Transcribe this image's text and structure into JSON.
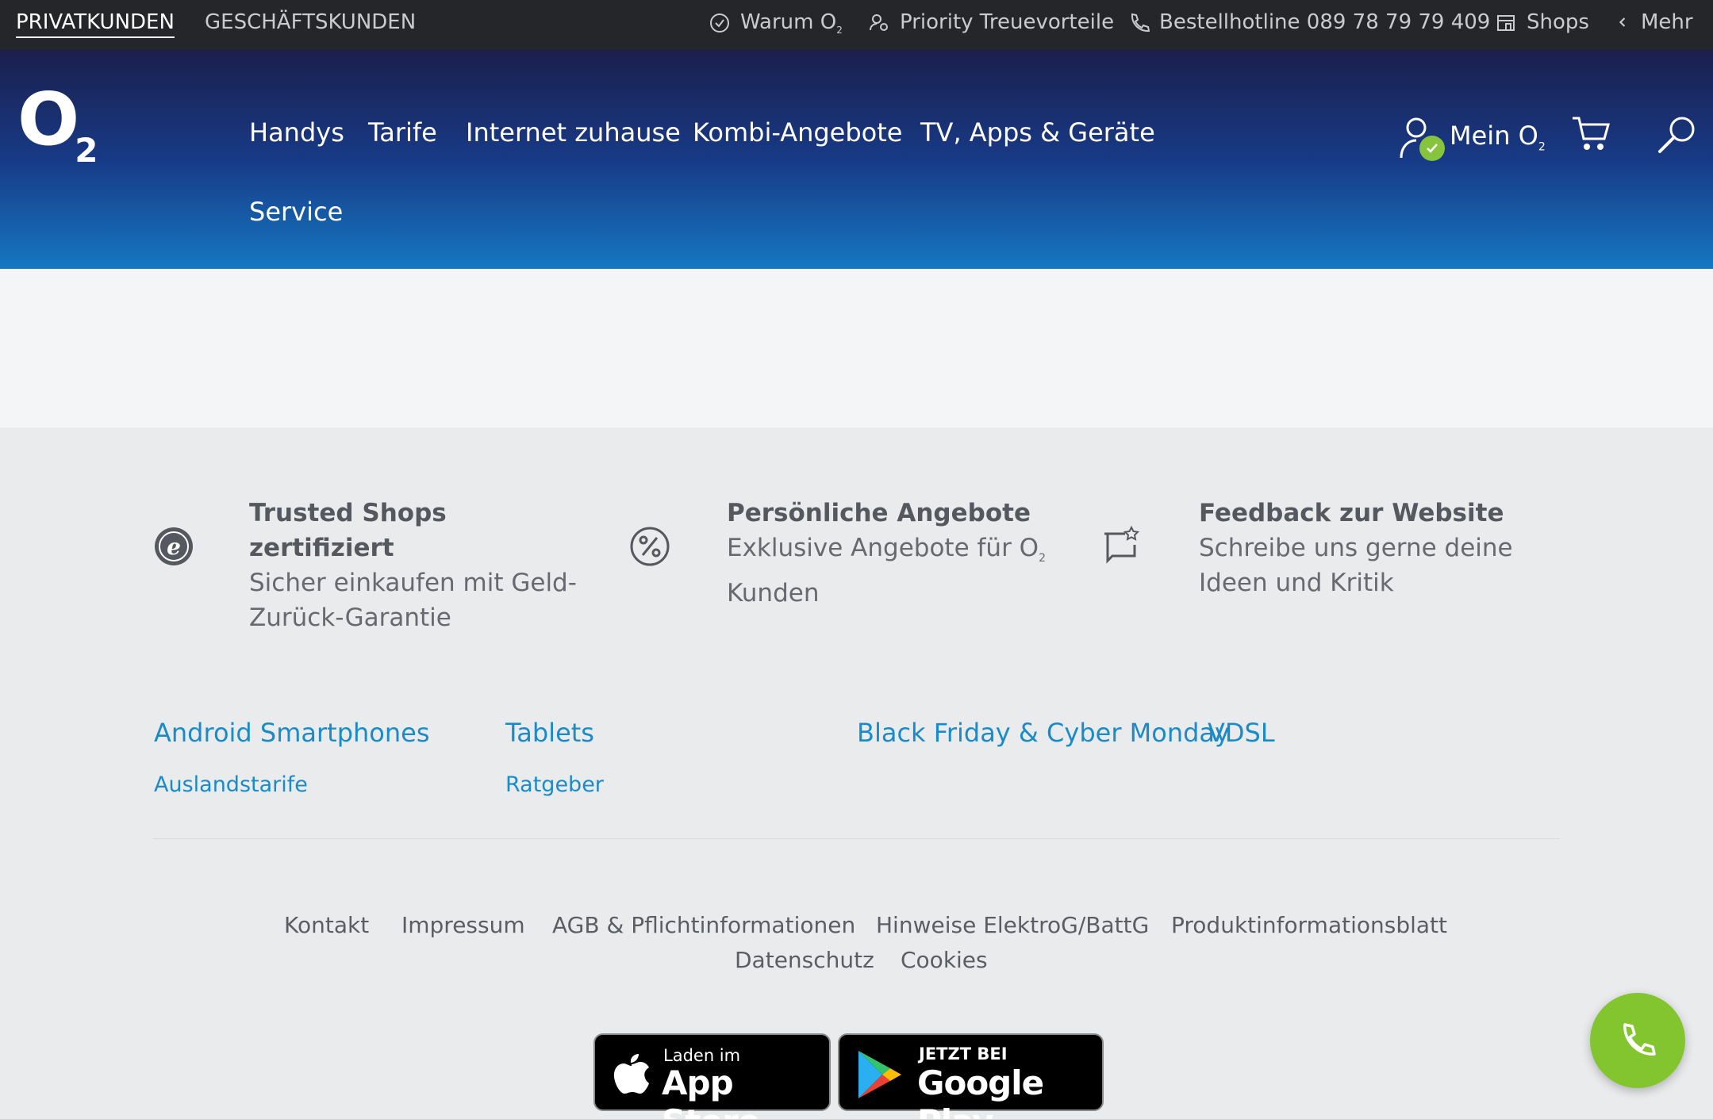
{
  "topbar": {
    "segments": [
      "PRIVATKUNDEN",
      "GESCHÄFTSKUNDEN"
    ],
    "warum": "Warum O",
    "warum_sub": "2",
    "priority": "Priority Treuevorteile",
    "hotline": "Bestellhotline 089 78 79 79 409",
    "shops": "Shops",
    "mehr": "Mehr"
  },
  "header": {
    "logo": "O",
    "logo_sub": "2",
    "nav": [
      "Handys",
      "Tarife",
      "Internet zuhause",
      "Kombi-Angebote",
      "TV, Apps & Geräte",
      "Service"
    ],
    "mein": "Mein O",
    "mein_sub": "2"
  },
  "features": [
    {
      "title": "Trusted Shops zertifiziert",
      "line1": "Sicher einkaufen mit Geld-",
      "line2": "Zurück-Garantie",
      "icon": "trusted-shops-icon"
    },
    {
      "title": "Persönliche Angebote",
      "line1": "Exklusive Angebote für O",
      "line1_sub": "2",
      "line2": "Kunden",
      "icon": "percent-icon"
    },
    {
      "title": "Feedback zur Website",
      "line1": "Schreibe uns gerne deine",
      "line2": "Ideen und Kritik",
      "icon": "feedback-icon"
    }
  ],
  "links": {
    "big": [
      "Android Smartphones",
      "Tablets",
      "Black Friday & Cyber Monday",
      "VDSL"
    ],
    "small": [
      "Auslandstarife",
      "Ratgeber"
    ]
  },
  "footer_links": [
    "Kontakt",
    "Impressum",
    "AGB & Pflichtinformationen",
    "Hinweise ElektroG/BattG",
    "Produktinformationsblatt",
    "Datenschutz",
    "Cookies"
  ],
  "badges": {
    "apple_small": "Laden im",
    "apple_large": "App Store",
    "google_small": "JETZT BEI",
    "google_large": "Google Play"
  },
  "colors": {
    "accent_green": "#82c52e",
    "link_blue": "#1a8bc9",
    "header_dark": "#1b1f4d",
    "header_light": "#1577c2"
  }
}
